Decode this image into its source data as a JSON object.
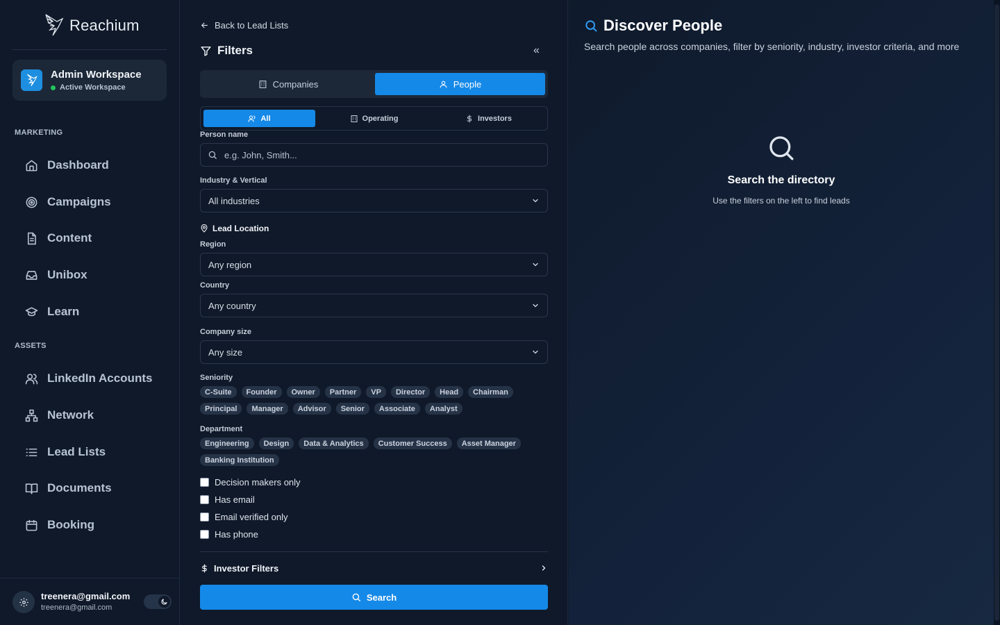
{
  "brand": {
    "name": "Reachium"
  },
  "workspace": {
    "title": "Admin Workspace",
    "status": "Active Workspace"
  },
  "sidebar": {
    "sections": [
      {
        "label": "MARKETING",
        "items": [
          {
            "label": "Dashboard",
            "icon": "home-icon"
          },
          {
            "label": "Campaigns",
            "icon": "target-icon"
          },
          {
            "label": "Content",
            "icon": "document-icon"
          },
          {
            "label": "Unibox",
            "icon": "inbox-icon"
          },
          {
            "label": "Learn",
            "icon": "graduation-cap-icon"
          }
        ]
      },
      {
        "label": "ASSETS",
        "items": [
          {
            "label": "LinkedIn Accounts",
            "icon": "users-icon"
          },
          {
            "label": "Network",
            "icon": "network-icon"
          },
          {
            "label": "Lead Lists",
            "icon": "list-icon"
          },
          {
            "label": "Documents",
            "icon": "book-icon"
          },
          {
            "label": "Booking",
            "icon": "calendar-icon"
          }
        ]
      }
    ]
  },
  "user": {
    "name": "treenera@gmail.com",
    "email": "treenera@gmail.com"
  },
  "filters": {
    "back_label": "Back to Lead Lists",
    "title": "Filters",
    "collapse_glyph": "«",
    "main_tabs": [
      {
        "label": "Companies",
        "active": false
      },
      {
        "label": "People",
        "active": true
      }
    ],
    "sub_tabs": [
      {
        "label": "All",
        "active": true
      },
      {
        "label": "Operating",
        "active": false
      },
      {
        "label": "Investors",
        "active": false
      }
    ],
    "person_name": {
      "label": "Person name",
      "placeholder": "e.g. John, Smith..."
    },
    "industry": {
      "label": "Industry & Vertical",
      "value": "All industries"
    },
    "location_heading": "Lead Location",
    "region": {
      "label": "Region",
      "value": "Any region"
    },
    "country": {
      "label": "Country",
      "value": "Any country"
    },
    "company_size": {
      "label": "Company size",
      "value": "Any size"
    },
    "seniority": {
      "label": "Seniority",
      "options": [
        "C-Suite",
        "Founder",
        "Owner",
        "Partner",
        "VP",
        "Director",
        "Head",
        "Chairman",
        "Principal",
        "Manager",
        "Advisor",
        "Senior",
        "Associate",
        "Analyst"
      ]
    },
    "department": {
      "label": "Department",
      "options": [
        "Engineering",
        "Design",
        "Data & Analytics",
        "Customer Success",
        "Asset Manager",
        "Banking Institution"
      ]
    },
    "checkboxes": [
      {
        "label": "Decision makers only",
        "checked": false
      },
      {
        "label": "Has email",
        "checked": false
      },
      {
        "label": "Email verified only",
        "checked": false
      },
      {
        "label": "Has phone",
        "checked": false
      }
    ],
    "investor_filters_label": "Investor Filters",
    "search_label": "Search"
  },
  "main": {
    "title": "Discover People",
    "subtitle": "Search people across companies, filter by seniority, industry, investor criteria, and more",
    "empty_title": "Search the directory",
    "empty_subtitle": "Use the filters on the left to find leads"
  },
  "colors": {
    "accent": "#1589e8",
    "background": "#0f1929",
    "status_active": "#22c55e"
  }
}
